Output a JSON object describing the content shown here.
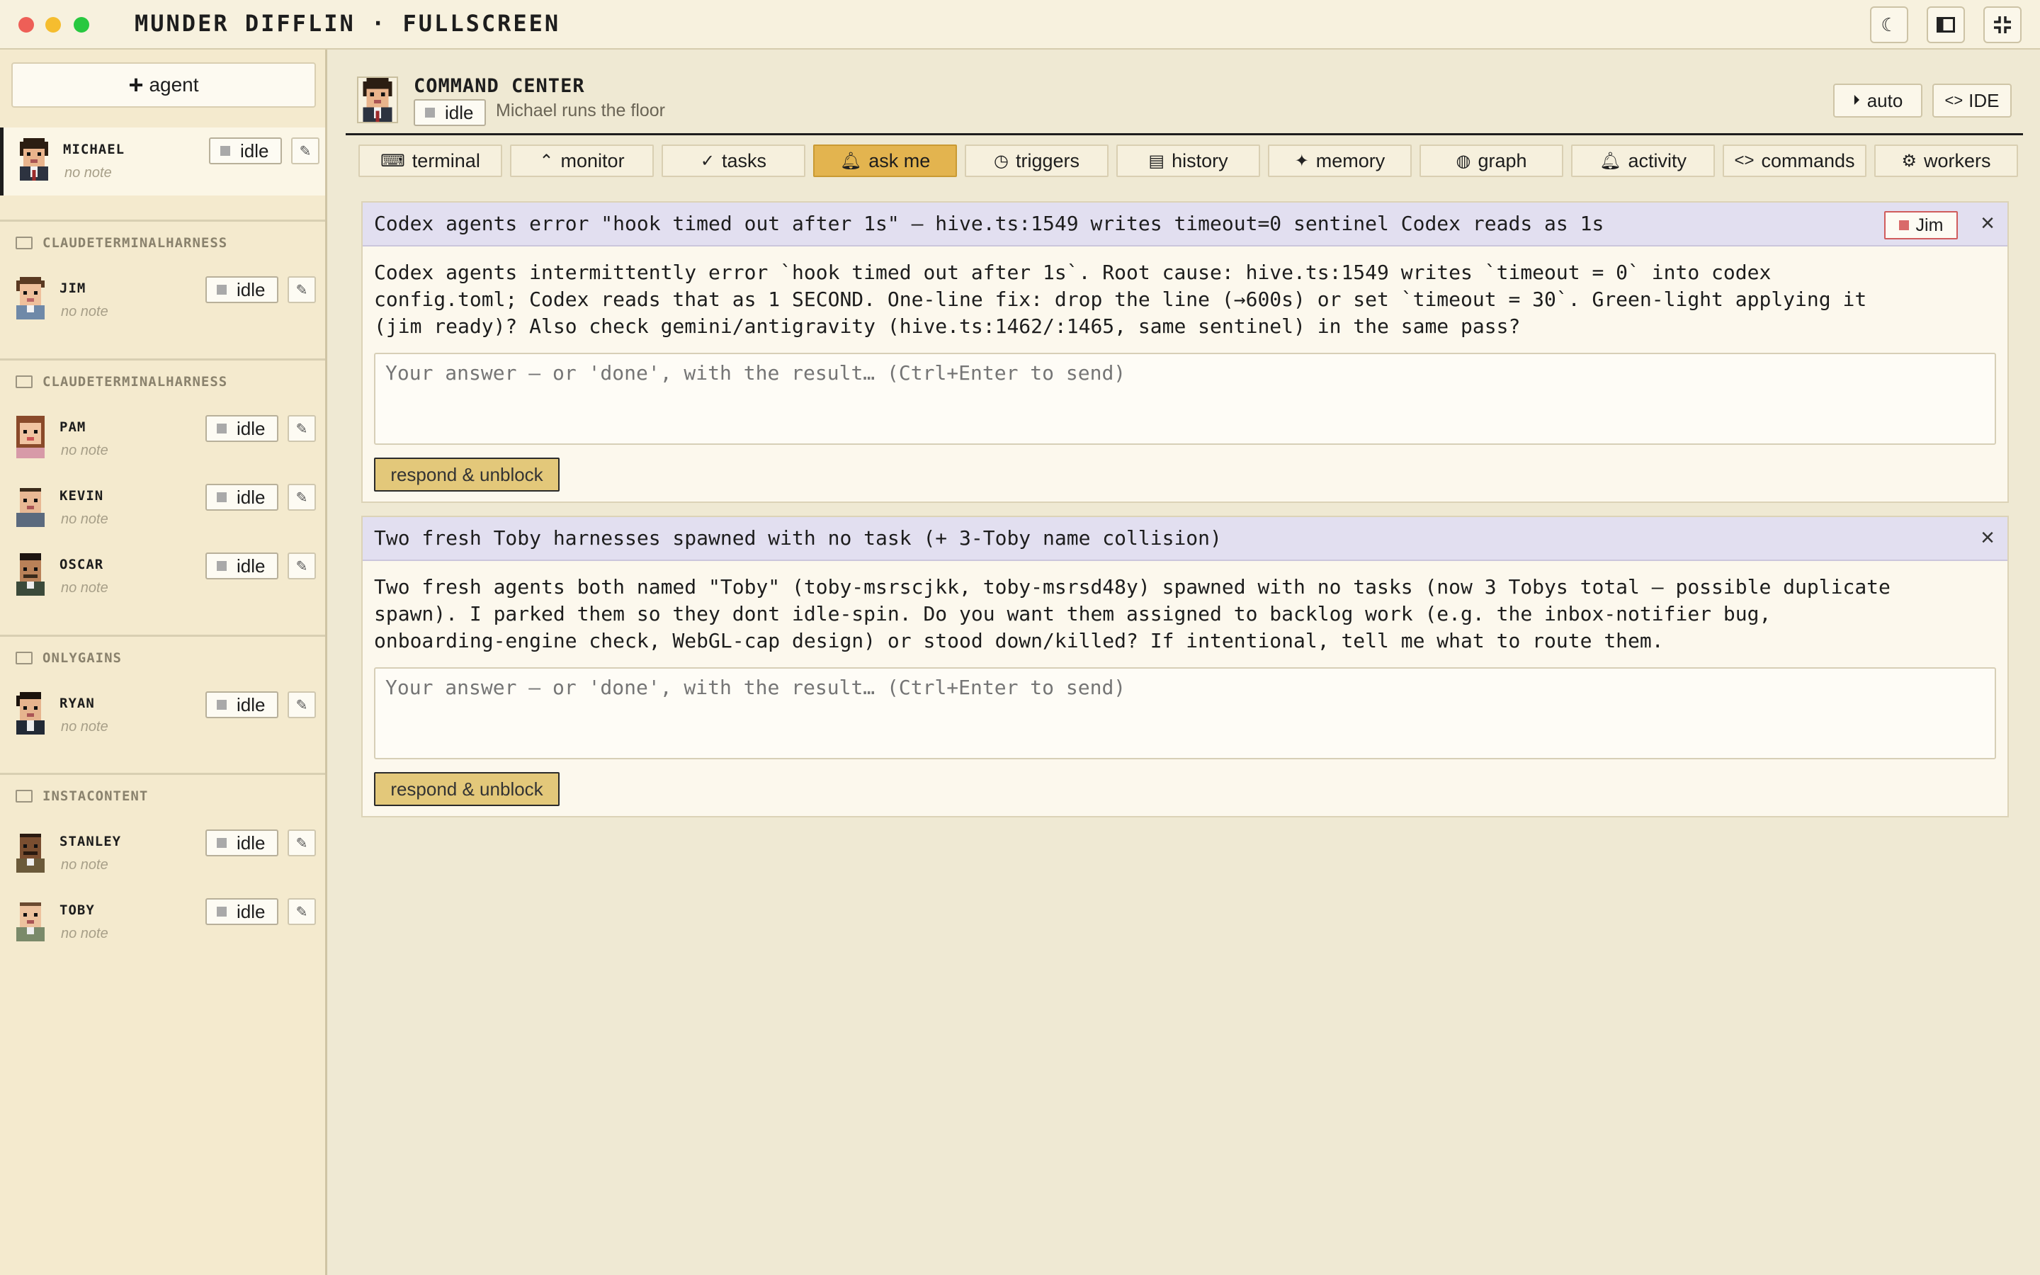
{
  "window": {
    "title": "MUNDER DIFFLIN · FULLSCREEN"
  },
  "titlebar_icons": [
    "moon-icon",
    "sidebar-toggle-icon",
    "exit-fullscreen-icon"
  ],
  "sidebar": {
    "add_agent_label": "agent",
    "state_label": "idle",
    "note_label": "no note",
    "groups": [
      {
        "label": "CLAUDETERMINALHARNESS"
      },
      {
        "label": "CLAUDETERMINALHARNESS"
      },
      {
        "label": "ONLYGAINS"
      },
      {
        "label": "INSTACONTENT"
      }
    ],
    "agents": [
      {
        "name": "MICHAEL",
        "state": "idle",
        "note": "no note"
      },
      {
        "name": "JIM",
        "state": "idle",
        "note": "no note"
      },
      {
        "name": "PAM",
        "state": "idle",
        "note": "no note"
      },
      {
        "name": "KEVIN",
        "state": "idle",
        "note": "no note"
      },
      {
        "name": "OSCAR",
        "state": "idle",
        "note": "no note"
      },
      {
        "name": "RYAN",
        "state": "idle",
        "note": "no note"
      },
      {
        "name": "STANLEY",
        "state": "idle",
        "note": "no note"
      },
      {
        "name": "TOBY",
        "state": "idle",
        "note": "no note"
      }
    ]
  },
  "header": {
    "title": "COMMAND CENTER",
    "state": "idle",
    "subtitle": "Michael runs the floor",
    "auto_label": "auto",
    "ide_label": "IDE"
  },
  "tabs": [
    {
      "label": "terminal",
      "icon": "terminal-icon"
    },
    {
      "label": "monitor",
      "icon": "monitor-icon"
    },
    {
      "label": "tasks",
      "icon": "check-icon"
    },
    {
      "label": "ask me",
      "icon": "bell-icon",
      "active": true
    },
    {
      "label": "triggers",
      "icon": "clock-icon"
    },
    {
      "label": "history",
      "icon": "document-icon"
    },
    {
      "label": "memory",
      "icon": "sparkle-icon"
    },
    {
      "label": "graph",
      "icon": "palette-icon"
    },
    {
      "label": "activity",
      "icon": "bell-icon"
    },
    {
      "label": "commands",
      "icon": "code-icon"
    },
    {
      "label": "workers",
      "icon": "gear-icon"
    }
  ],
  "questions": [
    {
      "title": "Codex agents error \"hook timed out after 1s\" — hive.ts:1549 writes timeout=0 sentinel Codex reads as 1s",
      "from": "Jim",
      "body": "Codex agents intermittently error `hook timed out after 1s`. Root cause: hive.ts:1549 writes `timeout = 0` into codex\nconfig.toml; Codex reads that as 1 SECOND. One-line fix: drop the line (→600s) or set `timeout = 30`. Green-light applying it\n(jim ready)? Also check gemini/antigravity (hive.ts:1462/:1465, same sentinel) in the same pass?",
      "placeholder": "Your answer — or 'done', with the result… (Ctrl+Enter to send)",
      "button": "respond & unblock"
    },
    {
      "title": "Two fresh Toby harnesses spawned with no task (+ 3-Toby name collision)",
      "body": "Two fresh agents both named \"Toby\" (toby-msrscjkk, toby-msrsd48y) spawned with no tasks (now 3 Tobys total — possible duplicate\nspawn). I parked them so they dont idle-spin. Do you want them assigned to backlog work (e.g. the inbox-notifier bug,\nonboarding-engine check, WebGL-cap design) or stood down/killed? If intentional, tell me what to route them.",
      "placeholder": "Your answer — or 'done', with the result… (Ctrl+Enter to send)",
      "button": "respond & unblock"
    }
  ]
}
